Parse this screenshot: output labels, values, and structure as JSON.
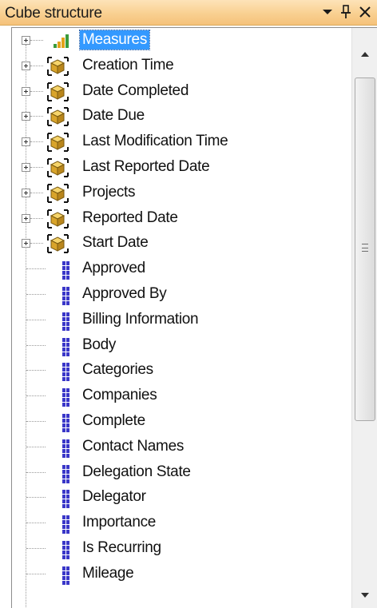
{
  "panel": {
    "title": "Cube structure",
    "buttons": {
      "dropdown_icon": "chevron-down-icon",
      "pin_icon": "pin-icon",
      "close_icon": "close-icon"
    }
  },
  "colors": {
    "titlebar_top": "#fde3b8",
    "titlebar_bottom": "#f5c27a",
    "selection": "#3399ff",
    "attribute_icon": "#3a37c8"
  },
  "tree": {
    "measures": {
      "label": "Measures",
      "icon": "measures-bar-icon",
      "selected": true
    },
    "dimensions": [
      {
        "label": "Creation Time",
        "icon": "cube-dimension-icon"
      },
      {
        "label": "Date Completed",
        "icon": "cube-dimension-icon"
      },
      {
        "label": "Date Due",
        "icon": "cube-dimension-icon"
      },
      {
        "label": "Last Modification Time",
        "icon": "cube-dimension-icon"
      },
      {
        "label": "Last Reported Date",
        "icon": "cube-dimension-icon"
      },
      {
        "label": "Projects",
        "icon": "cube-dimension-icon"
      },
      {
        "label": "Reported Date",
        "icon": "cube-dimension-icon"
      },
      {
        "label": "Start Date",
        "icon": "cube-dimension-icon"
      }
    ],
    "attributes": [
      {
        "label": "Approved",
        "icon": "attribute-icon"
      },
      {
        "label": "Approved By",
        "icon": "attribute-icon"
      },
      {
        "label": "Billing Information",
        "icon": "attribute-icon"
      },
      {
        "label": "Body",
        "icon": "attribute-icon"
      },
      {
        "label": "Categories",
        "icon": "attribute-icon"
      },
      {
        "label": "Companies",
        "icon": "attribute-icon"
      },
      {
        "label": "Complete",
        "icon": "attribute-icon"
      },
      {
        "label": "Contact Names",
        "icon": "attribute-icon"
      },
      {
        "label": "Delegation State",
        "icon": "attribute-icon"
      },
      {
        "label": "Delegator",
        "icon": "attribute-icon"
      },
      {
        "label": "Importance",
        "icon": "attribute-icon"
      },
      {
        "label": "Is Recurring",
        "icon": "attribute-icon"
      },
      {
        "label": "Mileage",
        "icon": "attribute-icon"
      }
    ]
  }
}
